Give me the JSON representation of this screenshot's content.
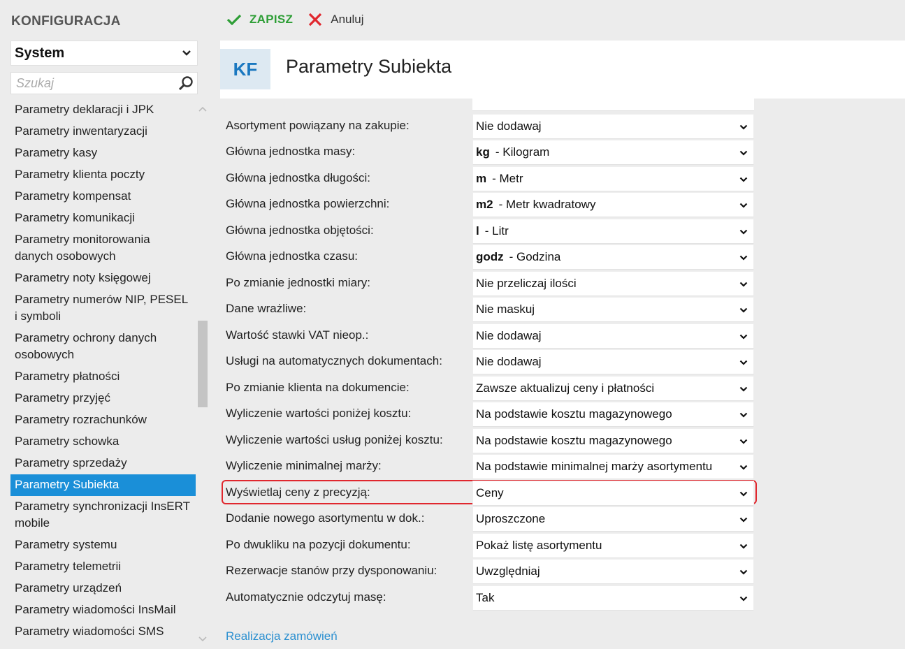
{
  "sidebar": {
    "title": "KONFIGURACJA",
    "group_select": "System",
    "search_placeholder": "Szukaj",
    "items": [
      {
        "label": "Parametry deklaracji i JPK",
        "active": false
      },
      {
        "label": "Parametry inwentaryzacji",
        "active": false
      },
      {
        "label": "Parametry kasy",
        "active": false
      },
      {
        "label": "Parametry klienta poczty",
        "active": false
      },
      {
        "label": "Parametry kompensat",
        "active": false
      },
      {
        "label": "Parametry komunikacji",
        "active": false
      },
      {
        "label": "Parametry monitorowania danych osobowych",
        "active": false
      },
      {
        "label": "Parametry noty księgowej",
        "active": false
      },
      {
        "label": "Parametry numerów NIP, PESEL i symboli",
        "active": false
      },
      {
        "label": "Parametry ochrony danych osobowych",
        "active": false
      },
      {
        "label": "Parametry płatności",
        "active": false
      },
      {
        "label": "Parametry przyjęć",
        "active": false
      },
      {
        "label": "Parametry rozrachunków",
        "active": false
      },
      {
        "label": "Parametry schowka",
        "active": false
      },
      {
        "label": "Parametry sprzedaży",
        "active": false
      },
      {
        "label": "Parametry Subiekta",
        "active": true
      },
      {
        "label": "Parametry synchronizacji InsERT mobile",
        "active": false
      },
      {
        "label": "Parametry systemu",
        "active": false
      },
      {
        "label": "Parametry telemetrii",
        "active": false
      },
      {
        "label": "Parametry urządzeń",
        "active": false
      },
      {
        "label": "Parametry wiadomości InsMail",
        "active": false
      },
      {
        "label": "Parametry wiadomości SMS",
        "active": false
      }
    ]
  },
  "toolbar": {
    "save_label": "ZAPISZ",
    "cancel_label": "Anuluj"
  },
  "header": {
    "badge": "KF",
    "title": "Parametry Subiekta"
  },
  "form": {
    "cut_off_field": "",
    "rows": [
      {
        "label": "Asortyment powiązany na zakupie:",
        "bold": "",
        "value": "Nie dodawaj"
      },
      {
        "label": "Główna jednostka masy:",
        "bold": "kg",
        "value": "- Kilogram"
      },
      {
        "label": "Główna jednostka długości:",
        "bold": "m",
        "value": "- Metr"
      },
      {
        "label": "Główna jednostka powierzchni:",
        "bold": "m2",
        "value": "- Metr kwadratowy"
      },
      {
        "label": "Główna jednostka objętości:",
        "bold": "l",
        "value": "- Litr"
      },
      {
        "label": "Główna jednostka czasu:",
        "bold": "godz",
        "value": "- Godzina"
      },
      {
        "label": "Po zmianie jednostki miary:",
        "bold": "",
        "value": "Nie przeliczaj ilości"
      },
      {
        "label": "Dane wrażliwe:",
        "bold": "",
        "value": "Nie maskuj"
      },
      {
        "label": "Wartość stawki VAT nieop.:",
        "bold": "",
        "value": "Nie dodawaj"
      },
      {
        "label": "Usługi na automatycznych dokumentach:",
        "bold": "",
        "value": "Nie dodawaj"
      },
      {
        "label": "Po zmianie klienta na dokumencie:",
        "bold": "",
        "value": "Zawsze aktualizuj ceny i płatności"
      },
      {
        "label": "Wyliczenie wartości poniżej kosztu:",
        "bold": "",
        "value": "Na podstawie kosztu magazynowego"
      },
      {
        "label": "Wyliczenie wartości usług poniżej kosztu:",
        "bold": "",
        "value": "Na podstawie kosztu magazynowego"
      },
      {
        "label": "Wyliczenie minimalnej marży:",
        "bold": "",
        "value": "Na podstawie minimalnej marży asortymentu"
      },
      {
        "label": "Wyświetlaj ceny z precyzją:",
        "bold": "",
        "value": "Ceny"
      },
      {
        "label": "Dodanie nowego asortymentu w dok.:",
        "bold": "",
        "value": "Uproszczone"
      },
      {
        "label": "Po dwukliku na pozycji dokumentu:",
        "bold": "",
        "value": "Pokaż listę asortymentu"
      },
      {
        "label": "Rezerwacje stanów przy dysponowaniu:",
        "bold": "",
        "value": "Uwzględniaj"
      },
      {
        "label": "Automatycznie odczytuj masę:",
        "bold": "",
        "value": "Tak"
      }
    ],
    "section_link": "Realizacja zamówień"
  },
  "colors": {
    "accent": "#1a8fd8",
    "save_green": "#2e9e36",
    "cancel_red": "#e0272e",
    "highlight_border": "#e0272e",
    "link": "#2a8fd0"
  }
}
